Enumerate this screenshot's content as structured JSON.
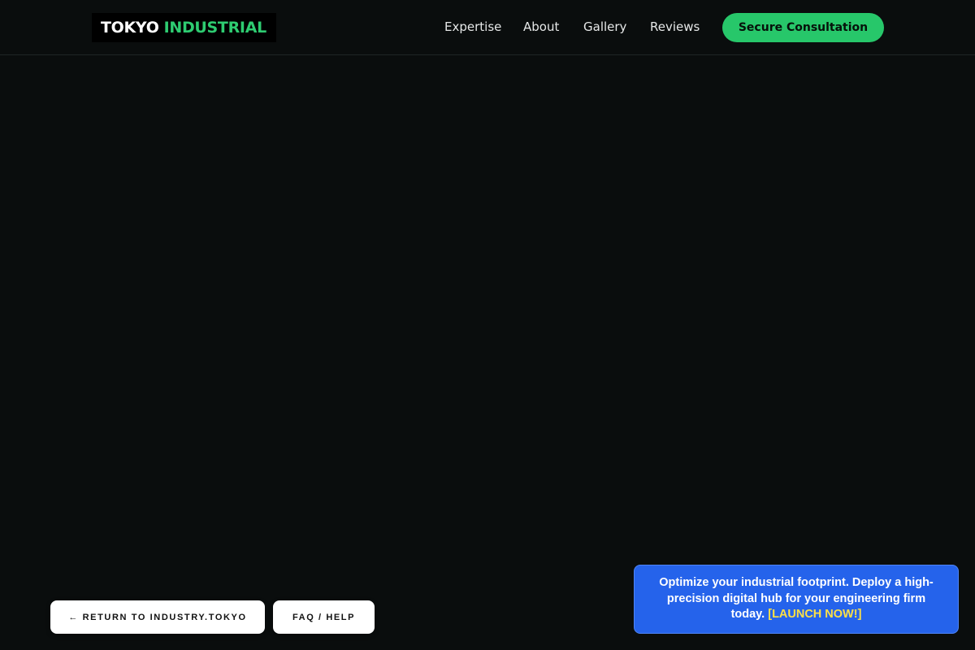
{
  "header": {
    "logo": {
      "part1": "TOKYO",
      "part2": "INDUSTRIAL"
    },
    "nav": [
      {
        "label": "Expertise"
      },
      {
        "label": "About"
      },
      {
        "label": "Gallery"
      },
      {
        "label": "Reviews"
      }
    ],
    "cta_label": "Secure Consultation"
  },
  "footer_buttons": {
    "return_label": "← RETURN TO INDUSTRY.TOKYO",
    "faq_label": "FAQ / HELP"
  },
  "promo": {
    "text": "Optimize your industrial footprint. Deploy a high-precision digital hub for your engineering firm today. ",
    "link_label": "[LAUNCH NOW!]"
  },
  "colors": {
    "background": "#0a0d0d",
    "accent": "#27c76a",
    "promo_bg": "#2563eb",
    "promo_link": "#fde047"
  }
}
